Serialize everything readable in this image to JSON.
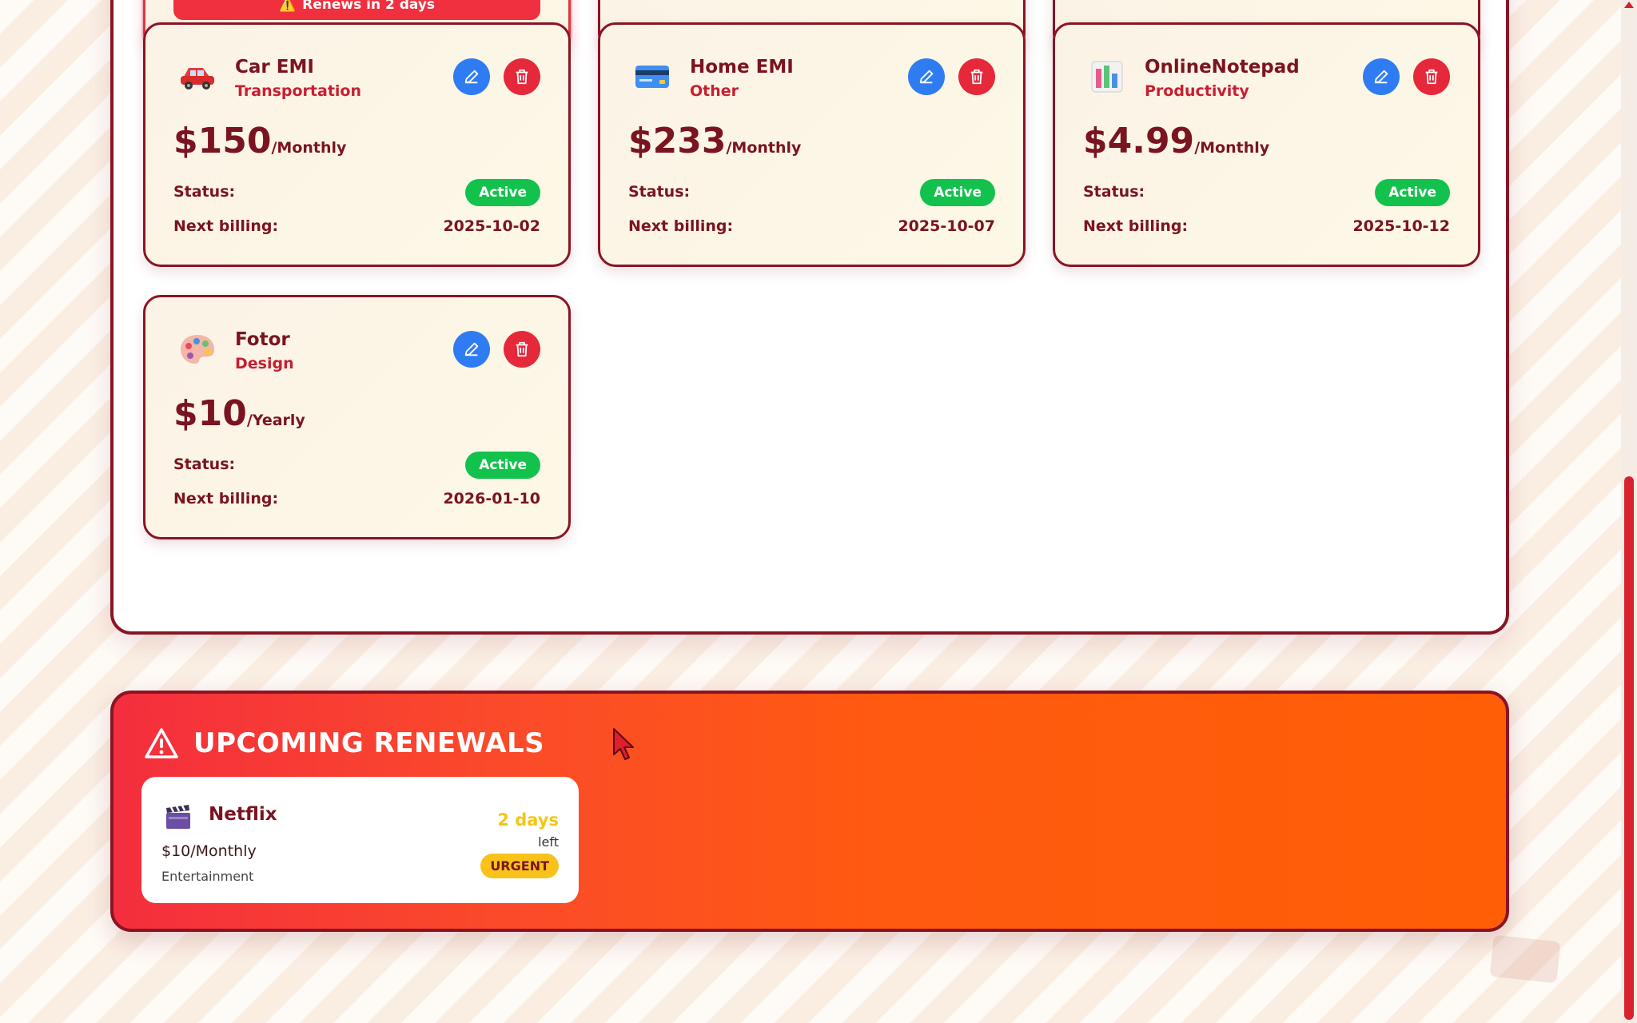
{
  "top_cards": [
    {
      "alert": true,
      "renew_text": "Renews in 2 days"
    },
    {
      "alert": false
    },
    {
      "alert": false
    }
  ],
  "subscriptions": [
    {
      "name": "Car EMI",
      "category": "Transportation",
      "price": "$150",
      "period": "/Monthly",
      "status_label": "Status:",
      "status": "Active",
      "billing_label": "Next billing:",
      "next_billing": "2025-10-02",
      "icon": "car-icon"
    },
    {
      "name": "Home EMI",
      "category": "Other",
      "price": "$233",
      "period": "/Monthly",
      "status_label": "Status:",
      "status": "Active",
      "billing_label": "Next billing:",
      "next_billing": "2025-10-07",
      "icon": "credit-card-icon"
    },
    {
      "name": "OnlineNotepad",
      "category": "Productivity",
      "price": "$4.99",
      "period": "/Monthly",
      "status_label": "Status:",
      "status": "Active",
      "billing_label": "Next billing:",
      "next_billing": "2025-10-12",
      "icon": "bar-chart-icon"
    },
    {
      "name": "Fotor",
      "category": "Design",
      "price": "$10",
      "period": "/Yearly",
      "status_label": "Status:",
      "status": "Active",
      "billing_label": "Next billing:",
      "next_billing": "2026-01-10",
      "icon": "palette-icon"
    }
  ],
  "renewals": {
    "title": "UPCOMING RENEWALS",
    "items": [
      {
        "name": "Netflix",
        "price": "$10/Monthly",
        "category": "Entertainment",
        "days": "2 days",
        "days_suffix": "left",
        "badge": "URGENT",
        "icon": "clapper-icon"
      }
    ]
  },
  "colors": {
    "primary": "#8a1424",
    "accent": "#e5283a",
    "edit": "#2f7cf2",
    "active": "#12c24c",
    "urgent": "#f8c21a",
    "orange": "#ff5e06"
  }
}
